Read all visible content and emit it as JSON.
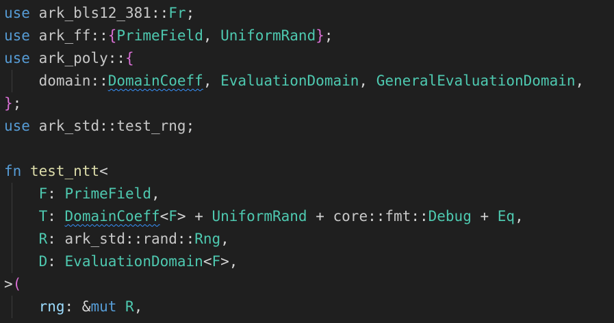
{
  "lines": [
    {
      "tokens": [
        {
          "t": "use",
          "c": "kw"
        },
        {
          "t": " ",
          "c": "pn"
        },
        {
          "t": "ark_bls12_381",
          "c": "ns"
        },
        {
          "t": "::",
          "c": "pn"
        },
        {
          "t": "Fr",
          "c": "ty"
        },
        {
          "t": ";",
          "c": "pn"
        }
      ]
    },
    {
      "tokens": [
        {
          "t": "use",
          "c": "kw"
        },
        {
          "t": " ",
          "c": "pn"
        },
        {
          "t": "ark_ff",
          "c": "ns"
        },
        {
          "t": "::",
          "c": "pn"
        },
        {
          "t": "{",
          "c": "br1"
        },
        {
          "t": "PrimeField",
          "c": "ty"
        },
        {
          "t": ", ",
          "c": "pn"
        },
        {
          "t": "UniformRand",
          "c": "ty"
        },
        {
          "t": "}",
          "c": "br1"
        },
        {
          "t": ";",
          "c": "pn"
        }
      ]
    },
    {
      "tokens": [
        {
          "t": "use",
          "c": "kw"
        },
        {
          "t": " ",
          "c": "pn"
        },
        {
          "t": "ark_poly",
          "c": "ns"
        },
        {
          "t": "::",
          "c": "pn"
        },
        {
          "t": "{",
          "c": "br1"
        }
      ]
    },
    {
      "guides": 1,
      "tokens": [
        {
          "t": "    ",
          "c": "pn"
        },
        {
          "t": "domain",
          "c": "ns"
        },
        {
          "t": "::",
          "c": "pn"
        },
        {
          "t": "DomainCoeff",
          "c": "ty squig"
        },
        {
          "t": ", ",
          "c": "pn"
        },
        {
          "t": "EvaluationDomain",
          "c": "ty"
        },
        {
          "t": ", ",
          "c": "pn"
        },
        {
          "t": "GeneralEvaluationDomain",
          "c": "ty"
        },
        {
          "t": ",",
          "c": "pn"
        }
      ]
    },
    {
      "tokens": [
        {
          "t": "}",
          "c": "br1"
        },
        {
          "t": ";",
          "c": "pn"
        }
      ]
    },
    {
      "tokens": [
        {
          "t": "use",
          "c": "kw"
        },
        {
          "t": " ",
          "c": "pn"
        },
        {
          "t": "ark_std",
          "c": "ns"
        },
        {
          "t": "::",
          "c": "pn"
        },
        {
          "t": "test_rng",
          "c": "ns"
        },
        {
          "t": ";",
          "c": "pn"
        }
      ]
    },
    {
      "tokens": []
    },
    {
      "tokens": [
        {
          "t": "fn",
          "c": "kw"
        },
        {
          "t": " ",
          "c": "pn"
        },
        {
          "t": "test_ntt",
          "c": "fn"
        },
        {
          "t": "<",
          "c": "pn"
        }
      ]
    },
    {
      "guides": 1,
      "tokens": [
        {
          "t": "    ",
          "c": "pn"
        },
        {
          "t": "F",
          "c": "ty"
        },
        {
          "t": ": ",
          "c": "pn"
        },
        {
          "t": "PrimeField",
          "c": "ty"
        },
        {
          "t": ",",
          "c": "pn"
        }
      ]
    },
    {
      "guides": 1,
      "tokens": [
        {
          "t": "    ",
          "c": "pn"
        },
        {
          "t": "T",
          "c": "ty"
        },
        {
          "t": ": ",
          "c": "pn"
        },
        {
          "t": "DomainCoeff",
          "c": "ty squig"
        },
        {
          "t": "<",
          "c": "pn"
        },
        {
          "t": "F",
          "c": "ty"
        },
        {
          "t": "> + ",
          "c": "pn"
        },
        {
          "t": "UniformRand",
          "c": "ty"
        },
        {
          "t": " + ",
          "c": "pn"
        },
        {
          "t": "core",
          "c": "ns"
        },
        {
          "t": "::",
          "c": "pn"
        },
        {
          "t": "fmt",
          "c": "ns"
        },
        {
          "t": "::",
          "c": "pn"
        },
        {
          "t": "Debug",
          "c": "ty"
        },
        {
          "t": " + ",
          "c": "pn"
        },
        {
          "t": "Eq",
          "c": "ty"
        },
        {
          "t": ",",
          "c": "pn"
        }
      ]
    },
    {
      "guides": 1,
      "tokens": [
        {
          "t": "    ",
          "c": "pn"
        },
        {
          "t": "R",
          "c": "ty"
        },
        {
          "t": ": ",
          "c": "pn"
        },
        {
          "t": "ark_std",
          "c": "ns"
        },
        {
          "t": "::",
          "c": "pn"
        },
        {
          "t": "rand",
          "c": "ns"
        },
        {
          "t": "::",
          "c": "pn"
        },
        {
          "t": "Rng",
          "c": "ty"
        },
        {
          "t": ",",
          "c": "pn"
        }
      ]
    },
    {
      "guides": 1,
      "tokens": [
        {
          "t": "    ",
          "c": "pn"
        },
        {
          "t": "D",
          "c": "ty"
        },
        {
          "t": ": ",
          "c": "pn"
        },
        {
          "t": "EvaluationDomain",
          "c": "ty"
        },
        {
          "t": "<",
          "c": "pn"
        },
        {
          "t": "F",
          "c": "ty"
        },
        {
          "t": ">,",
          "c": "pn"
        }
      ]
    },
    {
      "tokens": [
        {
          "t": ">",
          "c": "pn"
        },
        {
          "t": "(",
          "c": "br1"
        }
      ]
    },
    {
      "guides": 1,
      "tokens": [
        {
          "t": "    ",
          "c": "pn"
        },
        {
          "t": "rng",
          "c": "var"
        },
        {
          "t": ": &",
          "c": "pn"
        },
        {
          "t": "mut",
          "c": "kw"
        },
        {
          "t": " ",
          "c": "pn"
        },
        {
          "t": "R",
          "c": "ty"
        },
        {
          "t": ",",
          "c": "pn"
        }
      ]
    }
  ],
  "colors": {
    "background": "#1f1f1f",
    "keyword": "#569cd6",
    "type": "#4ec9b0",
    "function": "#dcdcaa",
    "variable": "#9cdcfe",
    "bracket_level1": "#da70d6",
    "squiggle": "#3794ff"
  }
}
